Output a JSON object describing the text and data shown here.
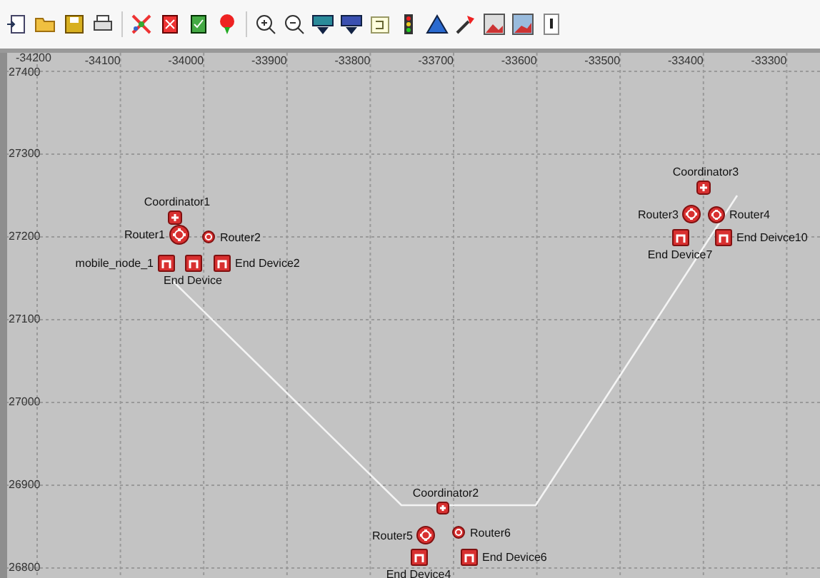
{
  "x_axis": {
    "ticks": [
      "-34200",
      "-34100",
      "-34000",
      "-33900",
      "-33800",
      "-33700",
      "-33600",
      "-33500",
      "-33400",
      "-33300"
    ]
  },
  "y_axis": {
    "ticks": [
      "27400",
      "27300",
      "27200",
      "27100",
      "27000",
      "26900",
      "26800"
    ]
  },
  "nodes": [
    {
      "kind": "coordinator",
      "label": "Coordinator1"
    },
    {
      "kind": "router",
      "label": "Router1"
    },
    {
      "kind": "router",
      "label": "Router2"
    },
    {
      "kind": "end_device",
      "label": "mobile_node_1"
    },
    {
      "kind": "end_device",
      "label": "End Device"
    },
    {
      "kind": "end_device",
      "label": "End Device2"
    },
    {
      "kind": "coordinator",
      "label": "Coordinator3"
    },
    {
      "kind": "router",
      "label": "Router3"
    },
    {
      "kind": "router",
      "label": "Router4"
    },
    {
      "kind": "end_device",
      "label": "End Device7"
    },
    {
      "kind": "end_device",
      "label": "End Deivce10"
    },
    {
      "kind": "coordinator",
      "label": "Coordinator2"
    },
    {
      "kind": "router",
      "label": "Router5"
    },
    {
      "kind": "router",
      "label": "Router6"
    },
    {
      "kind": "end_device",
      "label": "End Device4"
    },
    {
      "kind": "end_device",
      "label": "End Device6"
    }
  ]
}
